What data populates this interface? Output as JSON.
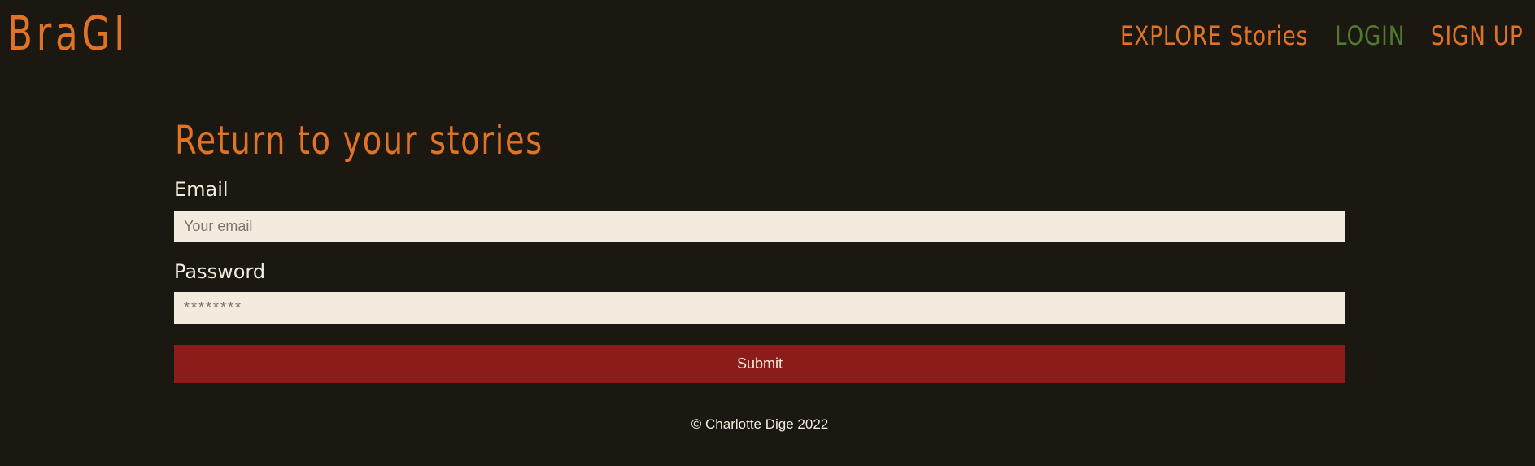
{
  "header": {
    "logo_text": "BraGI",
    "nav": {
      "explore_label": "EXPLORE Stories",
      "login_label": "LOGIN",
      "signup_label": "SIGN UP"
    }
  },
  "main": {
    "title": "Return to your stories",
    "email": {
      "label": "Email",
      "placeholder": "Your email",
      "value": ""
    },
    "password": {
      "label": "Password",
      "placeholder": "********",
      "value": ""
    },
    "submit_label": "Submit"
  },
  "footer": {
    "copyright": "© Charlotte Dige 2022"
  },
  "colors": {
    "background": "#1b1812",
    "accent_orange": "#e07325",
    "active_nav_green": "#4e7b2e",
    "input_background": "#f4ebdf",
    "submit_red": "#8b1c19",
    "text_light": "#f4ebdf"
  }
}
